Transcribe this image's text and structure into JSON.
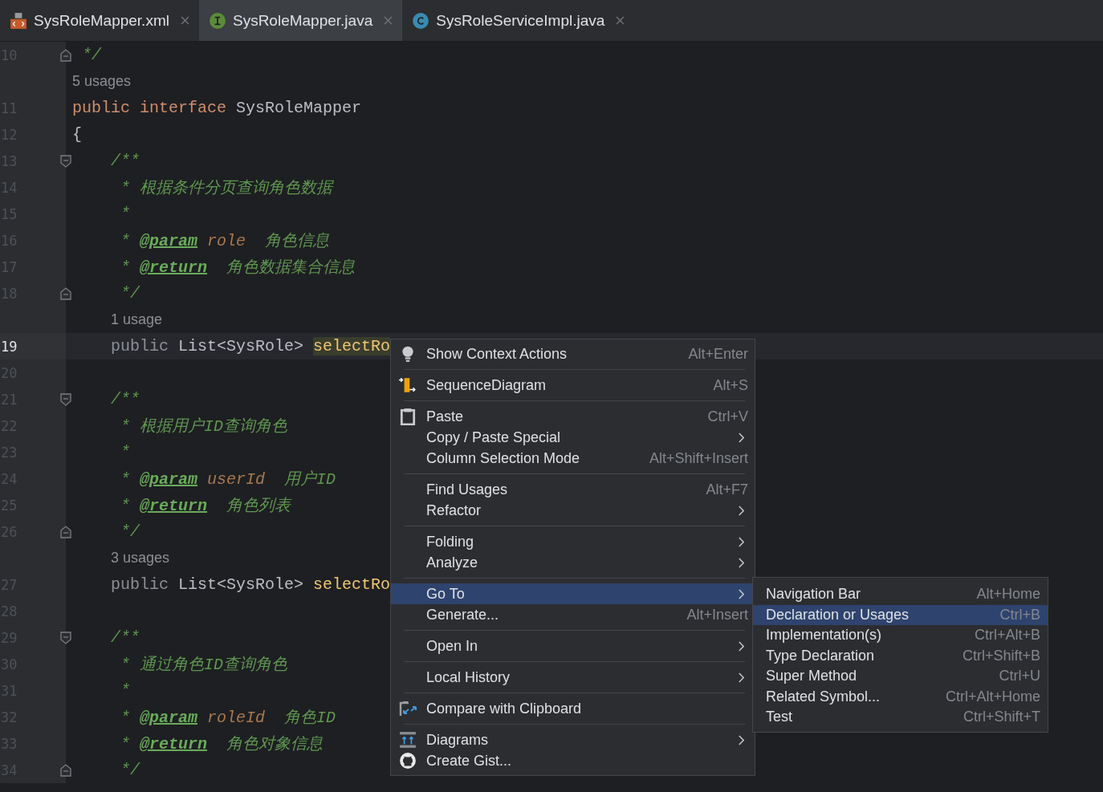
{
  "tabs": [
    {
      "kind": "xml",
      "label": "SysRoleMapper.xml",
      "selected": false
    },
    {
      "kind": "interface",
      "label": "SysRoleMapper.java",
      "selected": true
    },
    {
      "kind": "class",
      "label": "SysRoleServiceImpl.java",
      "selected": false
    }
  ],
  "editor": {
    "lines": [
      {
        "kind": "code",
        "number": "10",
        "fold_end": true,
        "current": false,
        "tokens": [
          {
            "kind": "comment",
            "text": " */"
          }
        ]
      },
      {
        "kind": "hint",
        "text": "5 usages",
        "nested": false
      },
      {
        "kind": "code",
        "number": "11",
        "current": false,
        "tokens": [
          {
            "kind": "keyword",
            "text": "public interface"
          },
          {
            "kind": "plain",
            "text": " SysRoleMapper"
          }
        ]
      },
      {
        "kind": "code",
        "number": "12",
        "current": false,
        "tokens": [
          {
            "kind": "plain",
            "text": "{"
          }
        ]
      },
      {
        "kind": "code",
        "number": "13",
        "fold_start": true,
        "current": false,
        "tokens": [
          {
            "kind": "comment",
            "text": "    /**"
          }
        ]
      },
      {
        "kind": "code",
        "number": "14",
        "current": false,
        "tokens": [
          {
            "kind": "comment",
            "text": "     * 根据条件分页查询角色数据"
          }
        ]
      },
      {
        "kind": "code",
        "number": "15",
        "current": false,
        "tokens": [
          {
            "kind": "comment",
            "text": "     *"
          }
        ]
      },
      {
        "kind": "code",
        "number": "16",
        "current": false,
        "tokens": [
          {
            "kind": "comment",
            "text": "     * "
          },
          {
            "kind": "doctag",
            "text": "@param"
          },
          {
            "kind": "param",
            "text": " role"
          },
          {
            "kind": "comment",
            "text": "  角色信息"
          }
        ]
      },
      {
        "kind": "code",
        "number": "17",
        "current": false,
        "tokens": [
          {
            "kind": "comment",
            "text": "     * "
          },
          {
            "kind": "doctag",
            "text": "@return"
          },
          {
            "kind": "comment",
            "text": "  角色数据集合信息"
          }
        ]
      },
      {
        "kind": "code",
        "number": "18",
        "fold_end": true,
        "current": false,
        "tokens": [
          {
            "kind": "comment",
            "text": "     */"
          }
        ]
      },
      {
        "kind": "hint",
        "text": "1 usage",
        "nested": true
      },
      {
        "kind": "code",
        "number": "19",
        "current": true,
        "tokens": [
          {
            "kind": "redundant",
            "text": "    public"
          },
          {
            "kind": "plain",
            "text": " List<SysRole> "
          },
          {
            "kind": "method-highlight",
            "text": "selectRo"
          }
        ]
      },
      {
        "kind": "code",
        "number": "20",
        "current": false
      },
      {
        "kind": "code",
        "number": "21",
        "fold_start": true,
        "current": false,
        "tokens": [
          {
            "kind": "comment",
            "text": "    /**"
          }
        ]
      },
      {
        "kind": "code",
        "number": "22",
        "current": false,
        "tokens": [
          {
            "kind": "comment",
            "text": "     * 根据用户ID查询角色"
          }
        ]
      },
      {
        "kind": "code",
        "number": "23",
        "current": false,
        "tokens": [
          {
            "kind": "comment",
            "text": "     *"
          }
        ]
      },
      {
        "kind": "code",
        "number": "24",
        "current": false,
        "tokens": [
          {
            "kind": "comment",
            "text": "     * "
          },
          {
            "kind": "doctag",
            "text": "@param"
          },
          {
            "kind": "param",
            "text": " userId"
          },
          {
            "kind": "comment",
            "text": "  用户ID"
          }
        ]
      },
      {
        "kind": "code",
        "number": "25",
        "current": false,
        "tokens": [
          {
            "kind": "comment",
            "text": "     * "
          },
          {
            "kind": "doctag",
            "text": "@return"
          },
          {
            "kind": "comment",
            "text": "  角色列表"
          }
        ]
      },
      {
        "kind": "code",
        "number": "26",
        "fold_end": true,
        "current": false,
        "tokens": [
          {
            "kind": "comment",
            "text": "     */"
          }
        ]
      },
      {
        "kind": "hint",
        "text": "3 usages",
        "nested": true
      },
      {
        "kind": "code",
        "number": "27",
        "current": false,
        "tokens": [
          {
            "kind": "redundant",
            "text": "    public"
          },
          {
            "kind": "plain",
            "text": " List<SysRole> "
          },
          {
            "kind": "method",
            "text": "selectRo"
          }
        ]
      },
      {
        "kind": "code",
        "number": "28",
        "current": false
      },
      {
        "kind": "code",
        "number": "29",
        "fold_start": true,
        "current": false,
        "tokens": [
          {
            "kind": "comment",
            "text": "    /**"
          }
        ]
      },
      {
        "kind": "code",
        "number": "30",
        "current": false,
        "tokens": [
          {
            "kind": "comment",
            "text": "     * 通过角色ID查询角色"
          }
        ]
      },
      {
        "kind": "code",
        "number": "31",
        "current": false,
        "tokens": [
          {
            "kind": "comment",
            "text": "     *"
          }
        ]
      },
      {
        "kind": "code",
        "number": "32",
        "current": false,
        "tokens": [
          {
            "kind": "comment",
            "text": "     * "
          },
          {
            "kind": "doctag",
            "text": "@param"
          },
          {
            "kind": "param",
            "text": " roleId"
          },
          {
            "kind": "comment",
            "text": "  角色ID"
          }
        ]
      },
      {
        "kind": "code",
        "number": "33",
        "current": false,
        "tokens": [
          {
            "kind": "comment",
            "text": "     * "
          },
          {
            "kind": "doctag",
            "text": "@return"
          },
          {
            "kind": "comment",
            "text": "  角色对象信息"
          }
        ]
      },
      {
        "kind": "code",
        "number": "34",
        "fold_end": true,
        "current": false,
        "tokens": [
          {
            "kind": "comment",
            "text": "     */"
          }
        ]
      }
    ]
  },
  "context_menu": {
    "items": [
      {
        "kind": "bulb",
        "label": "Show Context Actions",
        "shortcut": "Alt+Enter",
        "submenu": false,
        "selected": false
      },
      {
        "kind": "separator"
      },
      {
        "kind": "sequence",
        "label": "SequenceDiagram",
        "shortcut": "Alt+S",
        "submenu": false,
        "selected": false
      },
      {
        "kind": "separator"
      },
      {
        "kind": "clipboard",
        "label": "Paste",
        "shortcut": "Ctrl+V",
        "submenu": false,
        "selected": false
      },
      {
        "kind": "plain",
        "label": "Copy / Paste Special",
        "submenu": true,
        "selected": false
      },
      {
        "kind": "plain",
        "label": "Column Selection Mode",
        "shortcut": "Alt+Shift+Insert",
        "submenu": false,
        "selected": false
      },
      {
        "kind": "separator"
      },
      {
        "kind": "plain",
        "label": "Find Usages",
        "shortcut": "Alt+F7",
        "submenu": false,
        "selected": false
      },
      {
        "kind": "plain",
        "label": "Refactor",
        "submenu": true,
        "selected": false
      },
      {
        "kind": "separator"
      },
      {
        "kind": "plain",
        "label": "Folding",
        "submenu": true,
        "selected": false
      },
      {
        "kind": "plain",
        "label": "Analyze",
        "submenu": true,
        "selected": false
      },
      {
        "kind": "separator"
      },
      {
        "kind": "plain",
        "label": "Go To",
        "submenu": true,
        "selected": true
      },
      {
        "kind": "plain",
        "label": "Generate...",
        "shortcut": "Alt+Insert",
        "submenu": false,
        "selected": false
      },
      {
        "kind": "separator"
      },
      {
        "kind": "plain",
        "label": "Open In",
        "submenu": true,
        "selected": false
      },
      {
        "kind": "separator"
      },
      {
        "kind": "plain",
        "label": "Local History",
        "submenu": true,
        "selected": false
      },
      {
        "kind": "separator"
      },
      {
        "kind": "compare",
        "label": "Compare with Clipboard",
        "submenu": false,
        "selected": false
      },
      {
        "kind": "separator"
      },
      {
        "kind": "diagrams",
        "label": "Diagrams",
        "submenu": true,
        "selected": false
      },
      {
        "kind": "cat",
        "label": "Create Gist...",
        "submenu": false,
        "selected": false
      }
    ]
  },
  "submenu": {
    "items": [
      {
        "label": "Navigation Bar",
        "shortcut": "Alt+Home",
        "selected": false
      },
      {
        "label": "Declaration or Usages",
        "shortcut": "Ctrl+B",
        "selected": true
      },
      {
        "label": "Implementation(s)",
        "shortcut": "Ctrl+Alt+B",
        "selected": false
      },
      {
        "label": "Type Declaration",
        "shortcut": "Ctrl+Shift+B",
        "selected": false
      },
      {
        "label": "Super Method",
        "shortcut": "Ctrl+U",
        "selected": false
      },
      {
        "label": "Related Symbol...",
        "shortcut": "Ctrl+Alt+Home",
        "selected": false
      },
      {
        "label": "Test",
        "shortcut": "Ctrl+Shift+T",
        "selected": false
      }
    ]
  }
}
